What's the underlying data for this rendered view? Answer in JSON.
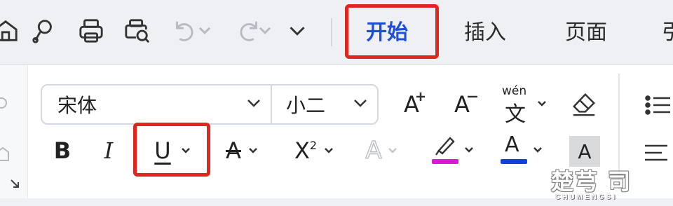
{
  "tabs": [
    {
      "label": "开始",
      "active": true
    },
    {
      "label": "插入",
      "active": false
    },
    {
      "label": "页面",
      "active": false
    },
    {
      "label": "引",
      "active": false
    }
  ],
  "quick_access": [
    {
      "icon": "home-icon"
    },
    {
      "icon": "format-painter-icon"
    },
    {
      "icon": "print-icon"
    },
    {
      "icon": "print-preview-icon"
    },
    {
      "icon": "undo-icon"
    },
    {
      "icon": "redo-icon"
    },
    {
      "icon": "more-chevron-icon"
    }
  ],
  "font": {
    "family_value": "宋体",
    "size_value": "小二"
  },
  "ribbon_buttons": {
    "increase_font_label": "A",
    "decrease_font_label": "A",
    "phonetic_label": "wén",
    "phonetic_char": "文",
    "bold_label": "B",
    "italic_label": "I",
    "underline_label": "U",
    "strike_label": "A",
    "superscript_label": "X",
    "superscript_mark": "2",
    "text_effect_label": "A",
    "highlight_color": "#d91ad9",
    "font_color_label": "A",
    "font_color": "#1542d6",
    "char_shading_label": "A"
  },
  "colors": {
    "accent": "#1f4fd8",
    "callout": "#e0261f"
  },
  "watermark": {
    "brand": "楚芎 司",
    "sub": "CHUMENGSI"
  }
}
